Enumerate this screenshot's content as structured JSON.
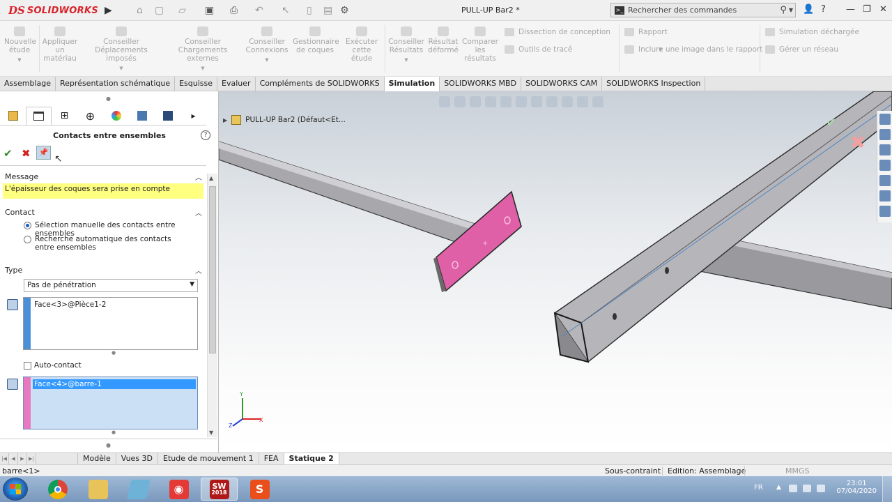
{
  "app": {
    "logo_prefix": "DS",
    "logo_name": "SOLIDWORKS",
    "document_title": "PULL-UP Bar2 *",
    "search_placeholder": "Rechercher des commandes"
  },
  "command_manager": {
    "buttons": [
      {
        "label": "Nouvelle\nétude"
      },
      {
        "label": "Appliquer\nun\nmatériau"
      },
      {
        "label": "Conseiller\nDéplacements imposés"
      },
      {
        "label": "Conseiller\nChargements externes"
      },
      {
        "label": "Conseiller\nConnexions"
      },
      {
        "label": "Gestionnaire\nde coques"
      },
      {
        "label": "Exécuter\ncette étude"
      },
      {
        "label": "Conseiller\nRésultats"
      },
      {
        "label": "Résultat\ndéformé"
      },
      {
        "label": "Comparer\nles\nrésultats"
      }
    ],
    "rows": [
      {
        "label": "Dissection de conception"
      },
      {
        "label": "Outils de tracé"
      },
      {
        "label": "Rapport"
      },
      {
        "label": "Inclure une image dans le rapport"
      },
      {
        "label": "Simulation déchargée"
      },
      {
        "label": "Gérer un réseau"
      }
    ]
  },
  "tabs": [
    {
      "label": "Assemblage"
    },
    {
      "label": "Représentation schématique"
    },
    {
      "label": "Esquisse"
    },
    {
      "label": "Evaluer"
    },
    {
      "label": "Compléments de SOLIDWORKS"
    },
    {
      "label": "Simulation",
      "active": true
    },
    {
      "label": "SOLIDWORKS MBD"
    },
    {
      "label": "SOLIDWORKS CAM"
    },
    {
      "label": "SOLIDWORKS Inspection"
    }
  ],
  "property_manager": {
    "title": "Contacts entre ensembles",
    "help": "?",
    "message_header": "Message",
    "message": "L'épaisseur des coques sera prise en compte",
    "contact_header": "Contact",
    "radio_manual": "Sélection manuelle des contacts entre ensembles",
    "radio_auto": "Recherche automatique des contacts entre ensembles",
    "type_header": "Type",
    "type_value": "Pas de pénétration",
    "set1_item": "Face<3>@Pièce1-2",
    "auto_contact": "Auto-contact",
    "set2_item": "Face<4>@barre-1"
  },
  "viewport": {
    "tree_label": "PULL-UP Bar2  (Défaut<Et..."
  },
  "bottom_tabs": [
    {
      "label": "Modèle"
    },
    {
      "label": "Vues 3D"
    },
    {
      "label": "Etude de mouvement 1"
    },
    {
      "label": "FEA"
    },
    {
      "label": "Statique 2",
      "active": true
    }
  ],
  "status": {
    "selection": "barre<1>",
    "constraint": "Sous-contraint",
    "edition": "Edition: Assemblage",
    "units": "MMGS"
  },
  "taskbar": {
    "lang": "FR",
    "time": "23:01",
    "date": "07/04/2020",
    "sw_version": "2018"
  },
  "colors": {
    "brand_red": "#d8232a",
    "message_yellow": "#ffff80",
    "set1_blue": "#4a90d9",
    "set2_pink": "#e879c0",
    "face_highlight": "#e060a8"
  }
}
